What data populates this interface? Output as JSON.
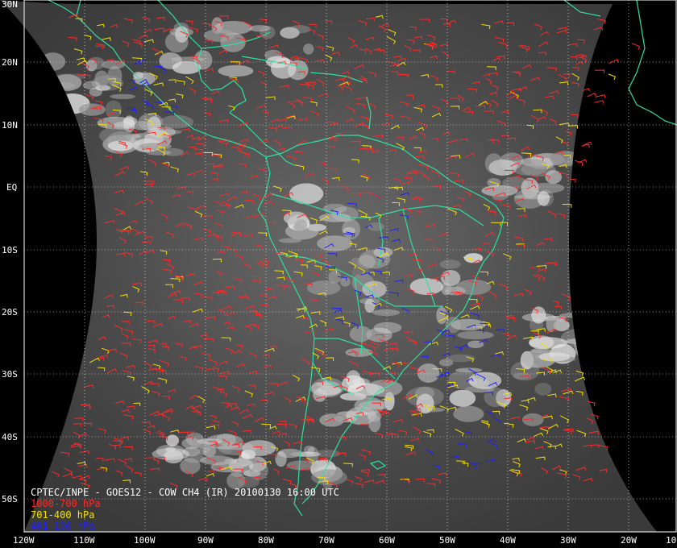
{
  "product": {
    "title": "CPTEC/INPE - GOES12 - COW CH4 (IR) 20100130 16:00 UTC"
  },
  "legend": [
    {
      "label": "1000-700 hPa",
      "color": "#ff2a2a"
    },
    {
      "label": "701-400 hPa",
      "color": "#f5e000"
    },
    {
      "label": "401-100 hPa",
      "color": "#2020ff"
    }
  ],
  "lat_labels": [
    "30N",
    "20N",
    "10N",
    "EQ",
    "10S",
    "20S",
    "30S",
    "40S",
    "50S"
  ],
  "lon_labels": [
    "120W",
    "110W",
    "100W",
    "90W",
    "80W",
    "70W",
    "60W",
    "50W",
    "40W",
    "30W",
    "20W",
    "10"
  ],
  "colors": {
    "coastline": "#2de0a0",
    "graticule": "#ffffff",
    "space": "#000000",
    "ir_background": "#555555"
  }
}
